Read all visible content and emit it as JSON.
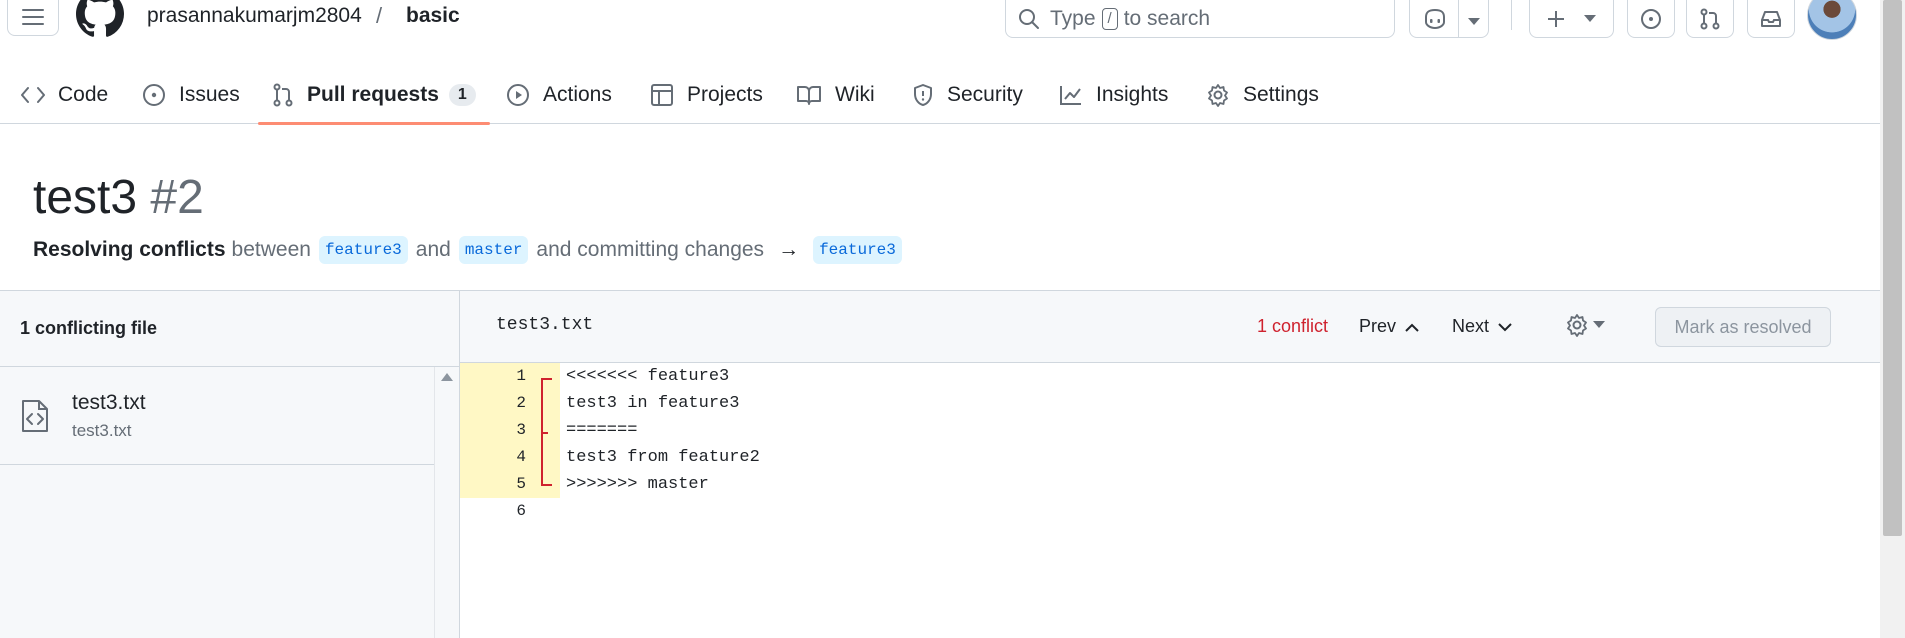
{
  "header": {
    "owner": "prasannakumarjm2804",
    "separator": "/",
    "repo": "basic",
    "search": {
      "prefix": "Type",
      "key": "/",
      "suffix": "to search"
    }
  },
  "nav": {
    "tabs": [
      {
        "label": "Code",
        "icon": "code-icon"
      },
      {
        "label": "Issues",
        "icon": "issue-opened-icon"
      },
      {
        "label": "Pull requests",
        "icon": "git-pull-request-icon",
        "count": "1",
        "active": true
      },
      {
        "label": "Actions",
        "icon": "play-icon"
      },
      {
        "label": "Projects",
        "icon": "table-icon"
      },
      {
        "label": "Wiki",
        "icon": "book-icon"
      },
      {
        "label": "Security",
        "icon": "shield-icon"
      },
      {
        "label": "Insights",
        "icon": "graph-icon"
      },
      {
        "label": "Settings",
        "icon": "gear-icon"
      }
    ]
  },
  "pr": {
    "title": "test3",
    "number": "#2",
    "subtitle": {
      "lead": "Resolving conflicts",
      "between": "between",
      "branch_a": "feature3",
      "and": "and",
      "branch_b": "master",
      "rest": "and committing changes",
      "arrow": "→",
      "target": "feature3"
    }
  },
  "sidebar": {
    "heading": "1 conflicting file",
    "file": {
      "name": "test3.txt",
      "path": "test3.txt"
    }
  },
  "editor": {
    "filename": "test3.txt",
    "conflict_count": "1 conflict",
    "prev": "Prev",
    "next": "Next",
    "mark_resolved": "Mark as resolved",
    "lines": [
      {
        "n": "1",
        "text": "<<<<<<< feature3",
        "conflict": true
      },
      {
        "n": "2",
        "text": "test3 in feature3",
        "conflict": true
      },
      {
        "n": "3",
        "text": "=======",
        "conflict": true
      },
      {
        "n": "4",
        "text": "test3 from feature2",
        "conflict": true
      },
      {
        "n": "5",
        "text": ">>>>>>> master",
        "conflict": true
      },
      {
        "n": "6",
        "text": "",
        "conflict": false
      }
    ]
  },
  "colors": {
    "accent_underline": "#fd8c73",
    "conflict_red": "#cf222e",
    "conflict_bg": "#fff8c5",
    "branch_bg": "#ddf4ff"
  }
}
